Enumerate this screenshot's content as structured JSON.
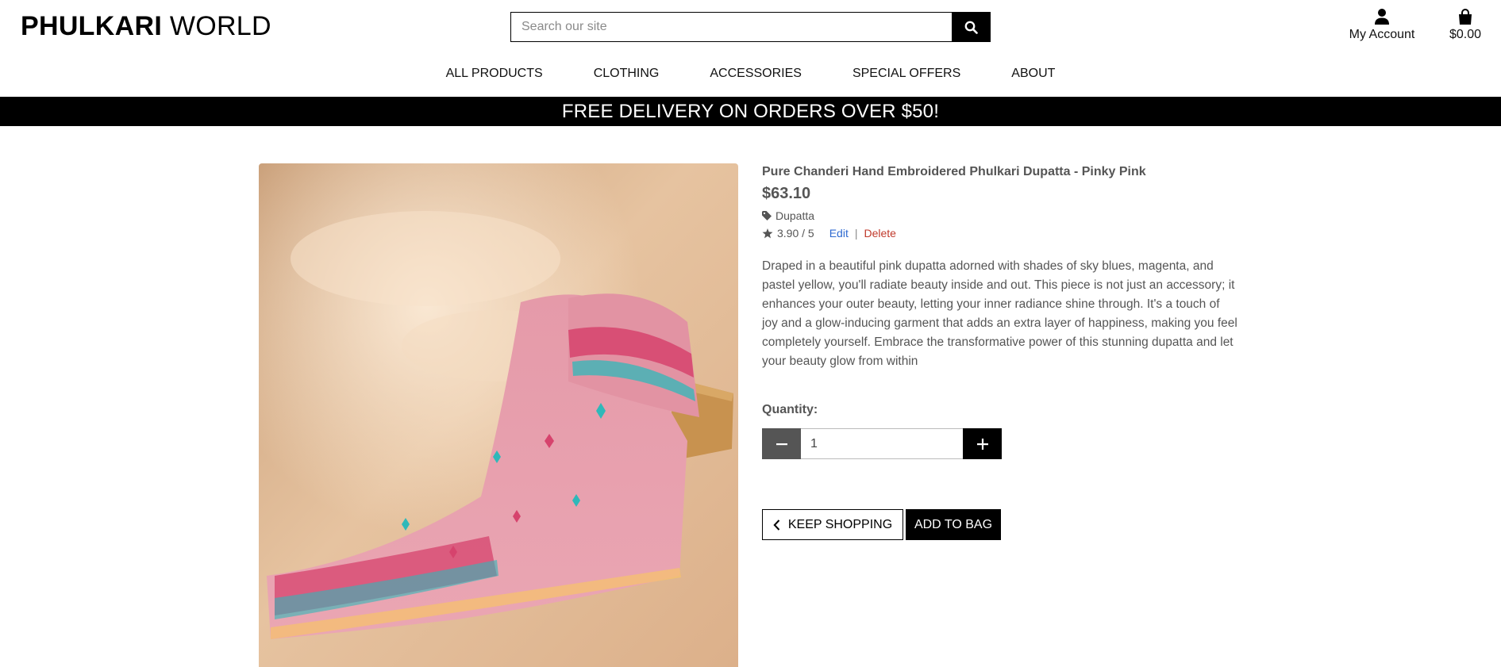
{
  "brand": {
    "name_bold": "PHULKARI",
    "name_light": "WORLD"
  },
  "search": {
    "placeholder": "Search our site",
    "value": ""
  },
  "header": {
    "account_label": "My Account",
    "bag_total": "$0.00"
  },
  "nav": {
    "items": [
      {
        "label": "ALL PRODUCTS"
      },
      {
        "label": "CLOTHING"
      },
      {
        "label": "ACCESSORIES"
      },
      {
        "label": "SPECIAL OFFERS"
      },
      {
        "label": "ABOUT"
      }
    ]
  },
  "banner": {
    "text": "FREE DELIVERY ON ORDERS OVER $50!"
  },
  "product": {
    "name": "Pure Chanderi Hand Embroidered Phulkari Dupatta - Pinky Pink",
    "price": "$63.10",
    "category": "Dupatta",
    "rating": "3.90 / 5",
    "edit_label": "Edit",
    "separator": "|",
    "delete_label": "Delete",
    "description": "Draped in a beautiful pink dupatta adorned with shades of sky blues, magenta, and pastel yellow, you'll radiate beauty inside and out. This piece is not just an accessory; it enhances your outer beauty, letting your inner radiance shine through. It's a touch of joy and a glow-inducing garment that adds an extra layer of happiness, making you feel completely yourself. Embrace the transformative power of this stunning dupatta and let your beauty glow from within",
    "quantity_label": "Quantity:",
    "quantity_value": "1",
    "keep_shopping_label": "KEEP SHOPPING",
    "add_to_bag_label": "ADD TO BAG"
  },
  "colors": {
    "banner_bg": "#000000",
    "text_muted": "#555555",
    "edit_link": "#2f6ad0",
    "delete_link": "#c0392b",
    "dupatta_pink": "#e8a3b0",
    "background_beige": "#e6c19b"
  },
  "icons": {
    "search": "search-icon",
    "account": "user-icon",
    "bag": "shopping-bag-icon",
    "category": "tag-icon",
    "rating": "star-icon",
    "minus": "minus-icon",
    "plus": "plus-icon",
    "back": "chevron-left-icon"
  }
}
